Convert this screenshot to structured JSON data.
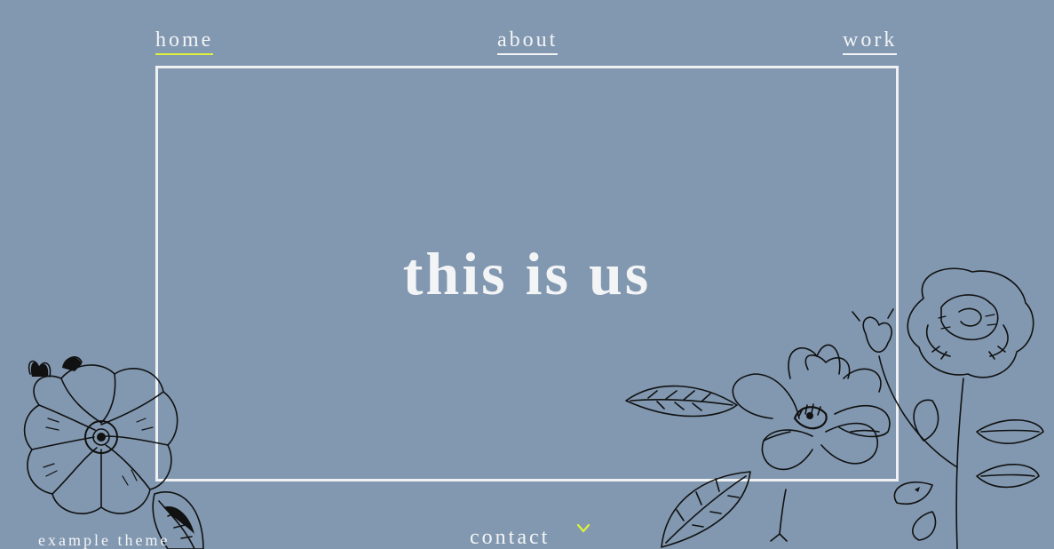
{
  "nav": {
    "home": "home",
    "about": "about",
    "work": "work"
  },
  "hero": {
    "title": "this is us"
  },
  "footer": {
    "brand": "example theme",
    "contact": "contact"
  },
  "icons": {
    "chevron": "chevron-down-icon",
    "flower_left": "wild-rose-illustration",
    "flower_right": "magnolia-rose-illustration"
  },
  "colors": {
    "background": "#8198b0",
    "text": "#f3f4f6",
    "accent": "#e0f23a",
    "ink": "#111111"
  }
}
